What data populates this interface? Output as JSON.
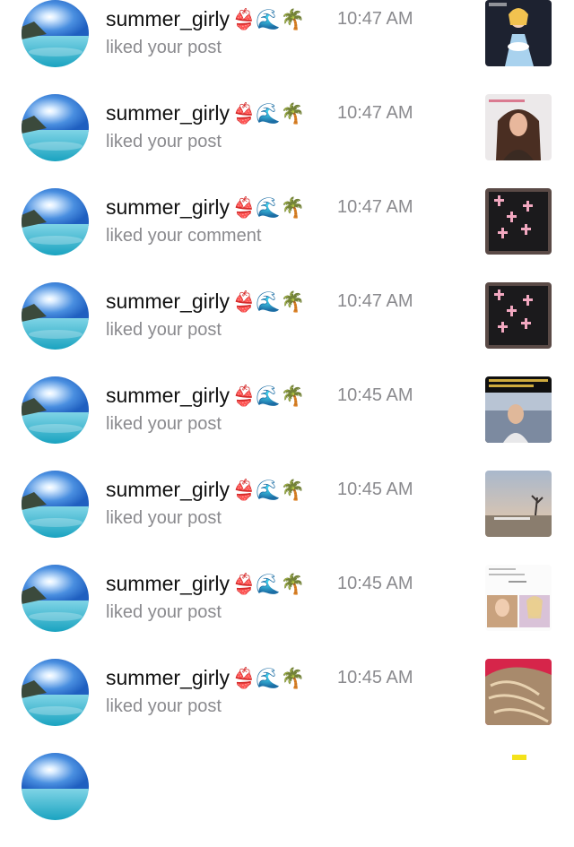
{
  "notifications": [
    {
      "username": "summer_girly",
      "emoji": "👙🌊🌴",
      "time": "10:47 AM",
      "action": "liked your post",
      "thumb": "cartoon-girl"
    },
    {
      "username": "summer_girly",
      "emoji": "👙🌊🌴",
      "time": "10:47 AM",
      "action": "liked your post",
      "thumb": "woman-selfie"
    },
    {
      "username": "summer_girly",
      "emoji": "👙🌊🌴",
      "time": "10:47 AM",
      "action": "liked your comment",
      "thumb": "pink-crosses"
    },
    {
      "username": "summer_girly",
      "emoji": "👙🌊🌴",
      "time": "10:47 AM",
      "action": "liked your post",
      "thumb": "pink-crosses"
    },
    {
      "username": "summer_girly",
      "emoji": "👙🌊🌴",
      "time": "10:45 AM",
      "action": "liked your post",
      "thumb": "man-video"
    },
    {
      "username": "summer_girly",
      "emoji": "👙🌊🌴",
      "time": "10:45 AM",
      "action": "liked your post",
      "thumb": "sunset-road"
    },
    {
      "username": "summer_girly",
      "emoji": "👙🌊🌴",
      "time": "10:45 AM",
      "action": "liked your post",
      "thumb": "profile-grid"
    },
    {
      "username": "summer_girly",
      "emoji": "👙🌊🌴",
      "time": "10:45 AM",
      "action": "liked your post",
      "thumb": "blonde-hair"
    }
  ],
  "partial_row": {
    "thumb": "yellow-sticker"
  }
}
